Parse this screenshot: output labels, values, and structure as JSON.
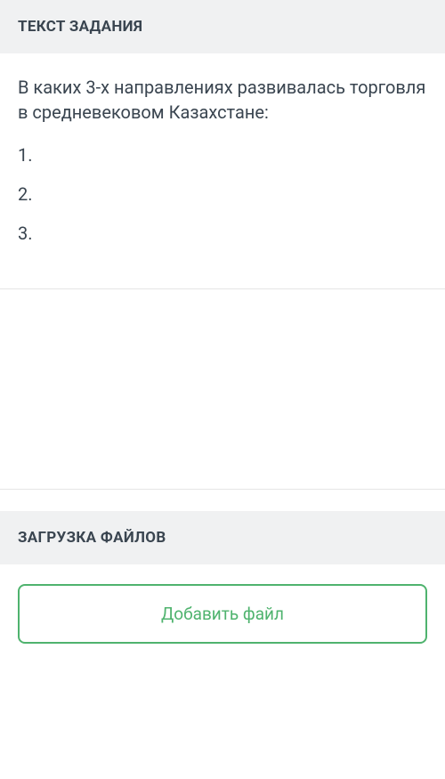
{
  "sections": {
    "task": {
      "header": "ТЕКСТ ЗАДАНИЯ",
      "question": "В каких 3-х направлениях развивалась торговля в средневековом Казахстане:",
      "items": [
        "1.",
        "2.",
        "3."
      ]
    },
    "upload": {
      "header": "ЗАГРУЗКА ФАЙЛОВ",
      "button_label": "Добавить файл"
    }
  }
}
